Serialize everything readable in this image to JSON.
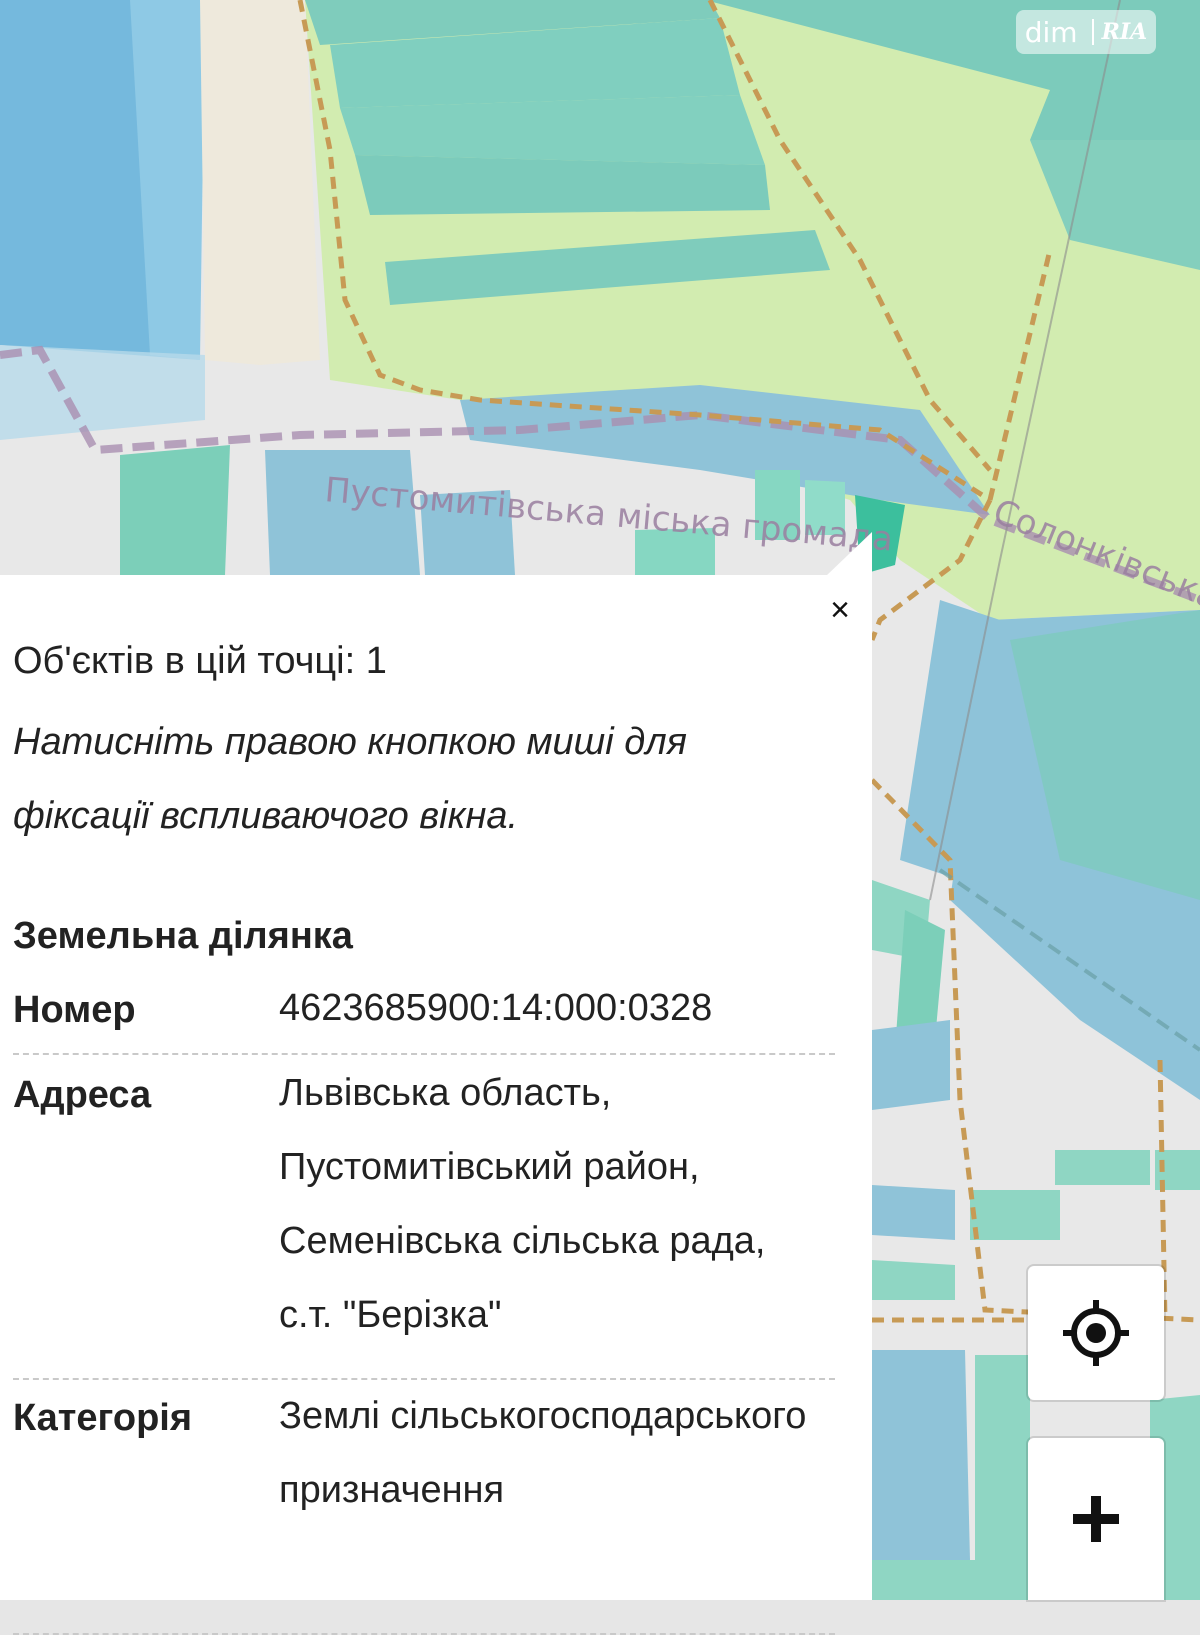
{
  "map": {
    "labels": {
      "community": "Пустомитівська міська громада",
      "community2": "Солонківська"
    }
  },
  "watermark": {
    "left": "dim",
    "right": "RIA"
  },
  "popup": {
    "close_symbol": "×",
    "objects_count": "Об'єктів в цій точці: 1",
    "hint": "Натисніть правою кнопкою миші для фіксації вспливаючого вікна.",
    "section_title": "Земельна ділянка",
    "rows": [
      {
        "label": "Номер",
        "value": "4623685900:14:000:0328"
      },
      {
        "label": "Адреса",
        "value": "Львівська область, Пустомитівський район, Семенівська сільська рада, с.т. \"Берізка\""
      },
      {
        "label": "Категорія",
        "value": "Землі сільськогосподарського призначення"
      }
    ]
  },
  "controls": {
    "locate_icon": "locate-target-icon",
    "zoom_in_icon": "plus-icon"
  },
  "colors": {
    "teal": "#7fcfbf",
    "blue": "#8ec3d9",
    "light_green": "#d3ecb0",
    "boundary": "#c79a55",
    "admin_line": "#a98fb0"
  }
}
